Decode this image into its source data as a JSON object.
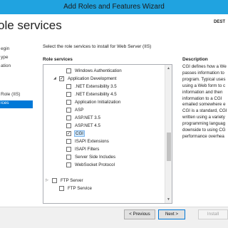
{
  "window": {
    "title": "Add Roles and Features Wizard"
  },
  "header": {
    "page_title": "ole services",
    "destination_label": "DEST"
  },
  "sidebar": {
    "items": [
      {
        "label": "egin",
        "selected": false
      },
      {
        "label": "ype",
        "selected": false
      },
      {
        "label": "ation",
        "selected": false
      },
      {
        "label": "Role (IIS)",
        "selected": false
      },
      {
        "label": "ices",
        "selected": true
      }
    ]
  },
  "main": {
    "intro": "Select the role services to install for Web Server (IIS)",
    "role_services_header": "Role services",
    "description_header": "Description"
  },
  "tree": {
    "rows": [
      {
        "label": "Windows Authentication",
        "checked": false,
        "expander": ""
      },
      {
        "label": "Application Development",
        "checked": true,
        "expander": "◢"
      },
      {
        "label": ".NET Extensibility 3.5",
        "checked": false,
        "expander": ""
      },
      {
        "label": ".NET Extensibility 4.5",
        "checked": false,
        "expander": ""
      },
      {
        "label": "Application Initialization",
        "checked": false,
        "expander": ""
      },
      {
        "label": "ASP",
        "checked": false,
        "expander": ""
      },
      {
        "label": "ASP.NET 3.5",
        "checked": false,
        "expander": ""
      },
      {
        "label": "ASP.NET 4.5",
        "checked": false,
        "expander": ""
      },
      {
        "label": "CGI",
        "checked": true,
        "expander": "",
        "highlighted": true
      },
      {
        "label": "ISAPI Extensions",
        "checked": false,
        "expander": ""
      },
      {
        "label": "ISAPI Filters",
        "checked": false,
        "expander": ""
      },
      {
        "label": "Server Side Includes",
        "checked": false,
        "expander": ""
      },
      {
        "label": "WebSocket Protocol",
        "checked": false,
        "expander": ""
      },
      {
        "label": "FTP Server",
        "checked": false,
        "expander": "▷"
      },
      {
        "label": "FTP Service",
        "checked": false,
        "expander": ""
      }
    ]
  },
  "description": {
    "lines": [
      "CGI defines how a We",
      "passes information to",
      "program. Typical uses",
      "using a Web form to c",
      "information and then",
      "information to a CGI",
      "emailed somewhere e",
      "CGI is a standard, CGI",
      "written using a variety",
      "programming languag",
      "downside to using CG",
      "performance overhea"
    ]
  },
  "footer": {
    "previous_label": "< Previous",
    "next_label": "Next >",
    "install_label": "Install"
  }
}
